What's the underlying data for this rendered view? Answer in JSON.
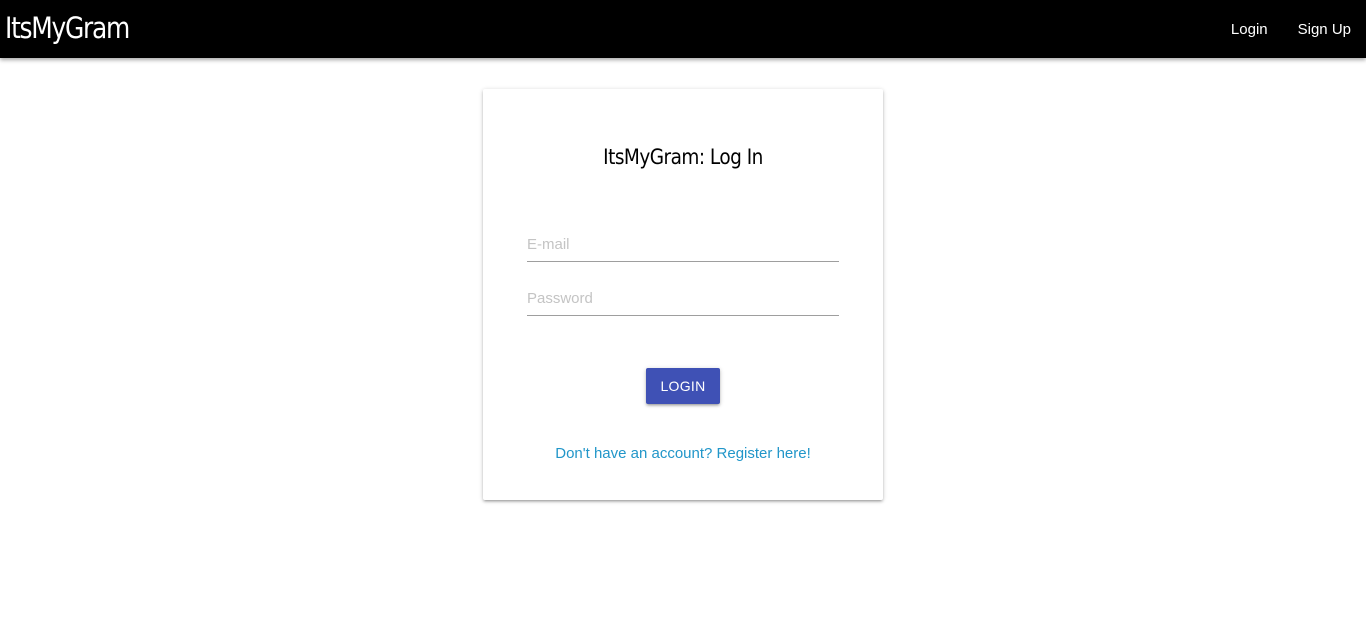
{
  "navbar": {
    "brand": "ItsMyGram",
    "links": [
      {
        "label": "Login"
      },
      {
        "label": "Sign Up"
      }
    ]
  },
  "login_card": {
    "title": "ItsMyGram: Log In",
    "email_placeholder": "E-mail",
    "password_placeholder": "Password",
    "submit_label": "LOGIN",
    "register_link": "Don't have an account? Register here!"
  },
  "colors": {
    "navbar_bg": "#000000",
    "button_bg": "#3f51b5",
    "link": "#2196c9"
  }
}
